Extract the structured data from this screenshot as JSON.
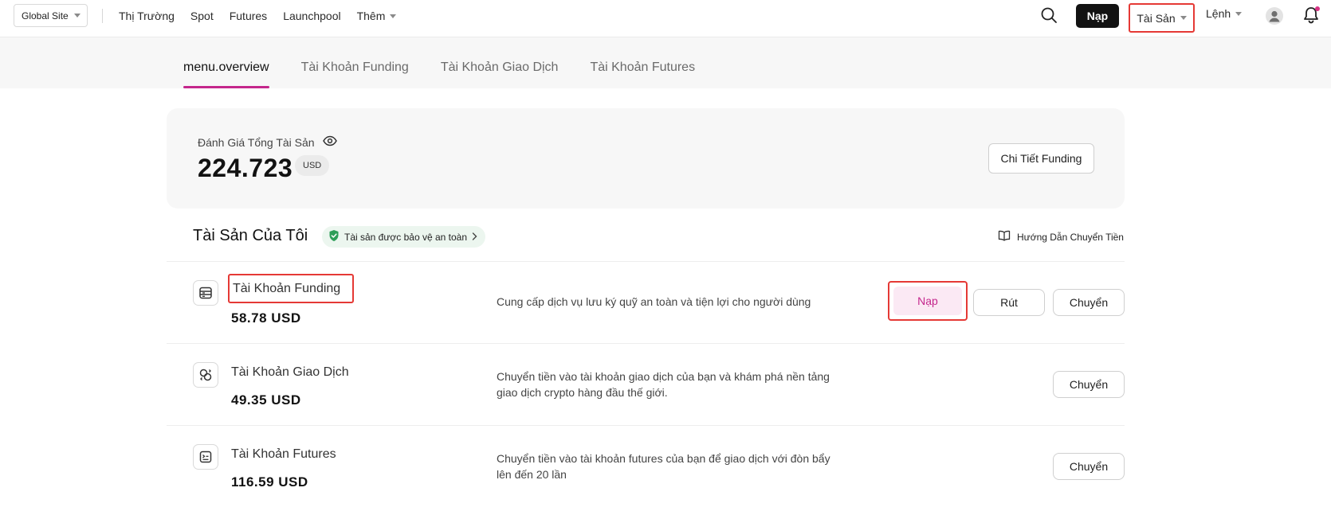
{
  "nav": {
    "site_selector": "Global Site",
    "links": [
      "Thị Trường",
      "Spot",
      "Futures",
      "Launchpool"
    ],
    "more_label": "Thêm",
    "deposit_label": "Nạp",
    "assets_label": "Tài Sản",
    "orders_label": "Lệnh"
  },
  "tabs": [
    "menu.overview",
    "Tài Khoản Funding",
    "Tài Khoản Giao Dịch",
    "Tài Khoản Futures"
  ],
  "summary": {
    "label": "Đánh Giá Tổng Tài Sản",
    "value": "224.723",
    "currency": "USD",
    "funding_detail_label": "Chi Tiết Funding"
  },
  "assets": {
    "title": "Tài Sản Của Tôi",
    "safe_badge": "Tài sản được bảo vệ an toàn",
    "guide_link": "Hướng Dẫn Chuyển Tiền"
  },
  "accounts": [
    {
      "name": "Tài Khoản Funding",
      "amount": "58.78 USD",
      "desc_lines": [
        "Cung cấp dịch vụ lưu ký quỹ an toàn và tiện lợi cho người dùng"
      ],
      "deposit_label": "Nạp",
      "withdraw_label": "Rút",
      "transfer_label": "Chuyển"
    },
    {
      "name": "Tài Khoản Giao Dịch",
      "amount": "49.35 USD",
      "desc_lines": [
        "Chuyển tiền vào tài khoản giao dịch của bạn và khám phá nền tảng",
        "giao dịch crypto hàng đầu thế giới."
      ],
      "transfer_label": "Chuyển"
    },
    {
      "name": "Tài Khoản Futures",
      "amount": "116.59 USD",
      "desc_lines": [
        "Chuyển tiền vào tài khoản futures của bạn để giao dịch với đòn bẩy",
        "lên đến 20 lần"
      ],
      "transfer_label": "Chuyển"
    }
  ],
  "colors": {
    "accent": "#c4268c",
    "highlight_box": "#e53935",
    "safe_green": "#2e9e58"
  }
}
